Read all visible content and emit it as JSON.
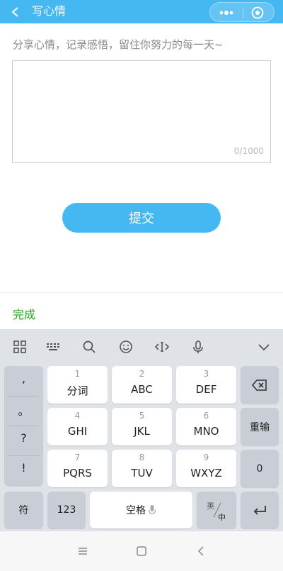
{
  "header": {
    "title": "写心情"
  },
  "form": {
    "hint": "分享心情，记录感悟，留住你努力的每一天~",
    "text_value": "",
    "counter": "0/1000",
    "submit_label": "提交"
  },
  "done_label": "完成",
  "keyboard": {
    "symbols": [
      ",",
      "。",
      "?",
      "!"
    ],
    "keys": [
      {
        "num": "1",
        "letters": "分词"
      },
      {
        "num": "2",
        "letters": "ABC"
      },
      {
        "num": "3",
        "letters": "DEF"
      },
      {
        "num": "4",
        "letters": "GHI"
      },
      {
        "num": "5",
        "letters": "JKL"
      },
      {
        "num": "6",
        "letters": "MNO"
      },
      {
        "num": "7",
        "letters": "PQRS"
      },
      {
        "num": "8",
        "letters": "TUV"
      },
      {
        "num": "9",
        "letters": "WXYZ"
      }
    ],
    "reinput_label": "重输",
    "zero_label": "0",
    "symbol_key_label": "符",
    "num_key_label": "123",
    "space_label": "空格",
    "lang_top": "英",
    "lang_bottom": "中"
  },
  "colors": {
    "accent": "#45b8f2",
    "done": "#1aad19",
    "keyboard_bg": "#dfe3e8"
  }
}
